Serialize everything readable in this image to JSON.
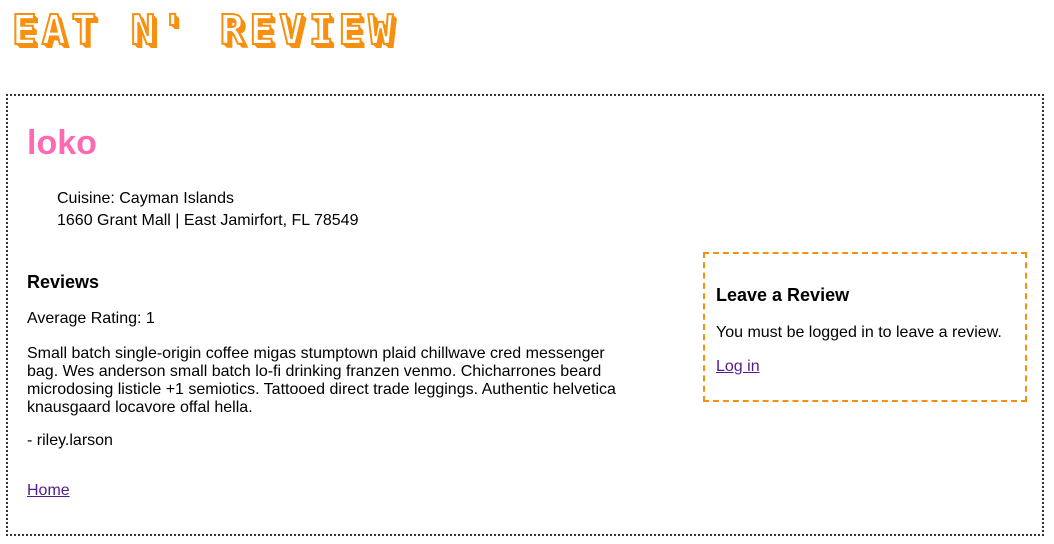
{
  "site": {
    "logo_text": "EAT N' REVIEW"
  },
  "restaurant": {
    "name": "loko",
    "cuisine": "Cuisine: Cayman Islands",
    "address": "1660 Grant Mall | East Jamirfort, FL 78549"
  },
  "reviews": {
    "heading": "Reviews",
    "average_rating": "Average Rating: 1",
    "items": [
      {
        "text": "Small batch single-origin coffee migas stumptown plaid chillwave cred messenger bag. Wes anderson small batch lo-fi drinking franzen venmo. Chicharrones beard microdosing listicle +1 semiotics. Tattooed direct trade leggings. Authentic helvetica knausgaard locavore offal hella.",
        "author": "- riley.larson"
      }
    ]
  },
  "nav": {
    "home_label": "Home"
  },
  "leave_review": {
    "heading": "Leave a Review",
    "message": "You must be logged in to leave a review.",
    "login_label": "Log in"
  },
  "colors": {
    "accent_orange": "#f7900e",
    "title_pink": "#ff69b4",
    "link_visited": "#551a8b"
  }
}
